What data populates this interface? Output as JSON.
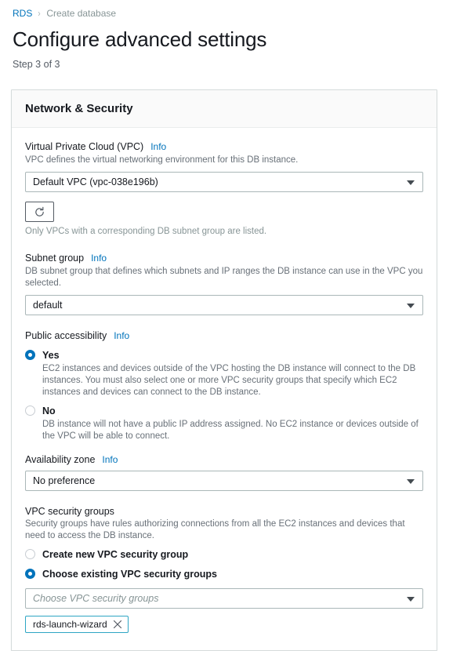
{
  "breadcrumb": {
    "root_label": "RDS",
    "separator": "›",
    "current_label": "Create database"
  },
  "page": {
    "title": "Configure advanced settings",
    "step": "Step 3 of 3"
  },
  "colors": {
    "link": "#0073bb",
    "selected_radio": "#0073bb",
    "token_border": "#2ea6c4",
    "card_border": "#d5dbdb",
    "card_header_bg": "#fafafa",
    "muted_text": "#687078"
  },
  "card": {
    "header_title": "Network & Security",
    "vpc": {
      "label": "Virtual Private Cloud (VPC)",
      "info_label": "Info",
      "description": "VPC defines the virtual networking environment for this DB instance.",
      "selected_value": "Default VPC (vpc-038e196b)",
      "options": [
        "Default VPC (vpc-038e196b)"
      ]
    },
    "refresh": {
      "icon": "refresh-icon",
      "note": "Only VPCs with a corresponding DB subnet group are listed."
    },
    "subnet_group": {
      "label": "Subnet group",
      "info_label": "Info",
      "description": "DB subnet group that defines which subnets and IP ranges the DB instance can use in the VPC you selected.",
      "selected_value": "default",
      "options": [
        "default"
      ]
    },
    "public_accessibility": {
      "label": "Public accessibility",
      "info_label": "Info",
      "options": [
        {
          "label": "Yes",
          "selected": true,
          "description": "EC2 instances and devices outside of the VPC hosting the DB instance will connect to the DB instances. You must also select one or more VPC security groups that specify which EC2 instances and devices can connect to the DB instance."
        },
        {
          "label": "No",
          "selected": false,
          "description": "DB instance will not have a public IP address assigned. No EC2 instance or devices outside of the VPC will be able to connect."
        }
      ]
    },
    "availability_zone": {
      "label": "Availability zone",
      "info_label": "Info",
      "selected_value": "No preference",
      "options": [
        "No preference"
      ]
    },
    "vpc_security_groups": {
      "label": "VPC security groups",
      "description": "Security groups have rules authorizing connections from all the EC2 instances and devices that need to access the DB instance.",
      "options": [
        {
          "label": "Create new VPC security group",
          "selected": false
        },
        {
          "label": "Choose existing VPC security groups",
          "selected": true
        }
      ],
      "select_placeholder": "Choose VPC security groups",
      "selected_tokens": [
        {
          "label": "rds-launch-wizard",
          "dismiss_icon": "close-icon"
        }
      ]
    }
  }
}
